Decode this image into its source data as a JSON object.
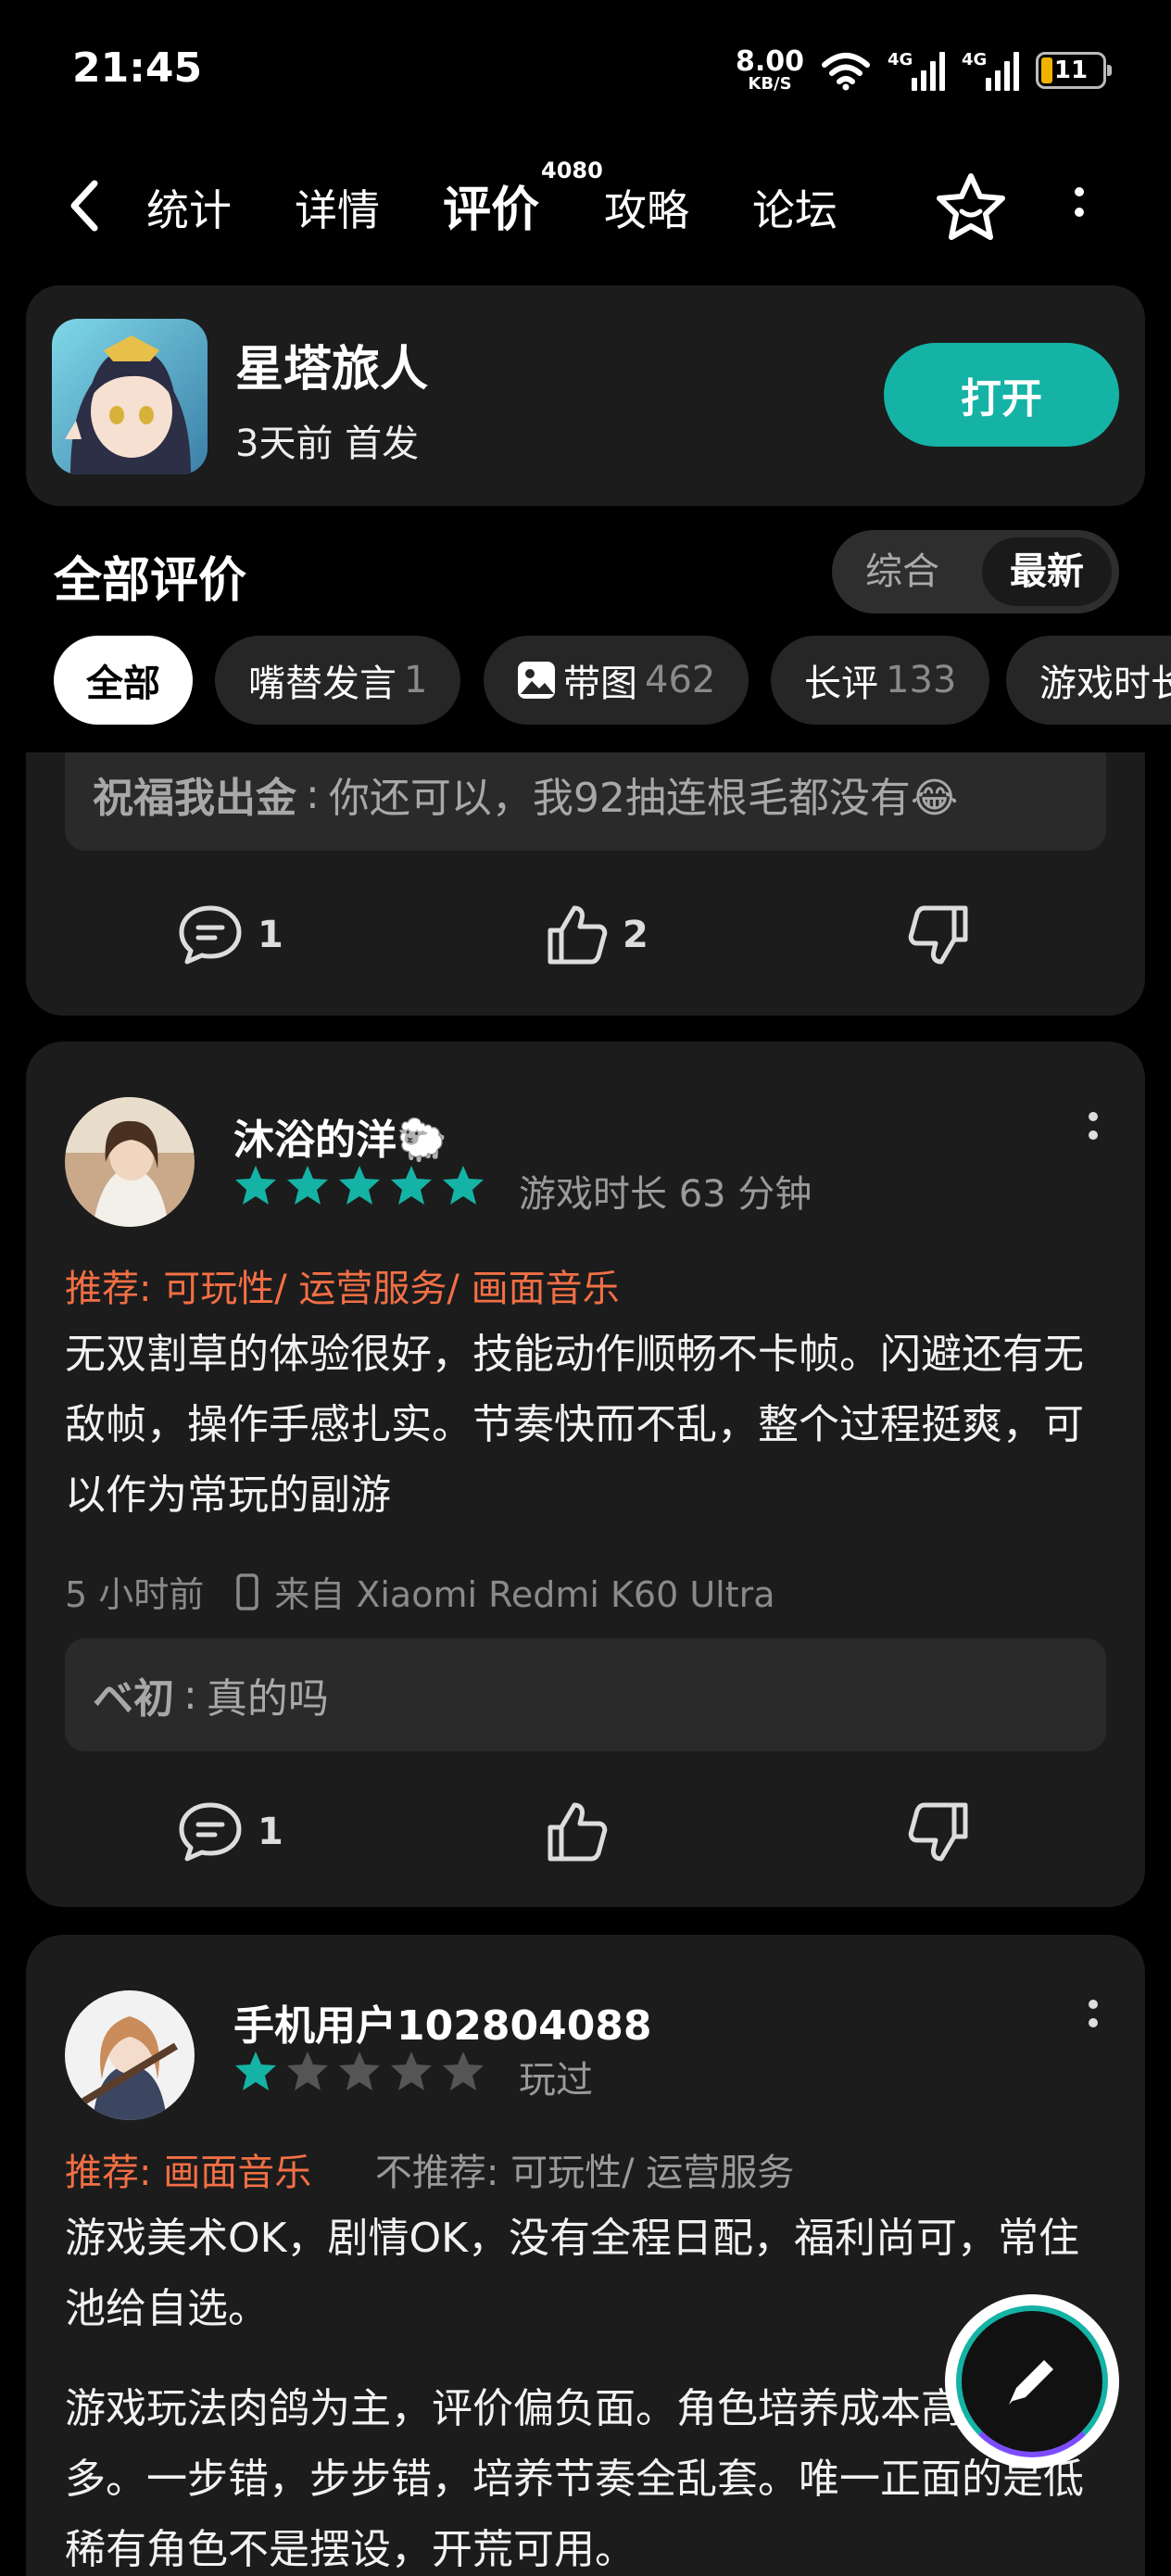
{
  "status_bar": {
    "time": "21:45",
    "net_speed": "8.00",
    "net_unit": "KB/S",
    "sim1": "4G",
    "sim2": "4G",
    "battery": "11"
  },
  "nav": {
    "tabs": [
      {
        "label": "统计"
      },
      {
        "label": "详情"
      },
      {
        "label": "评价",
        "badge": "4080"
      },
      {
        "label": "攻略"
      },
      {
        "label": "论坛"
      }
    ],
    "accent": "#15b3a5"
  },
  "game": {
    "title": "星塔旅人",
    "subtitle": "3天前 首发",
    "open_label": "打开"
  },
  "section": {
    "title": "全部评价",
    "sort_options": [
      "综合",
      "最新"
    ],
    "sort_selected": "最新"
  },
  "filters": [
    {
      "label": "全部",
      "count": ""
    },
    {
      "label": "嘴替发言",
      "count": "1"
    },
    {
      "label": "带图",
      "count": "462"
    },
    {
      "label": "长评",
      "count": "133"
    },
    {
      "label": "游戏时长",
      "count": ""
    }
  ],
  "reviews": [
    {
      "partial": true,
      "reply": {
        "name": "祝福我出金",
        "sep": ":",
        "text": "你还可以，我92抽连根毛都没有😂"
      },
      "comments": "1",
      "likes": "2"
    },
    {
      "username": "沐浴的洋🐑",
      "rating": 5,
      "playtime": "游戏时长 63 分钟",
      "recommend": "推荐: 可玩性/ 运营服务/ 画面音乐",
      "not_recommend": "",
      "text": "无双割草的体验很好，技能动作顺畅不卡帧。闪避还有无敌帧，操作手感扎实。节奏快而不乱，整个过程挺爽，可以作为常玩的副游",
      "time": "5 小时前",
      "device": "来自 Xiaomi Redmi K60 Ultra",
      "reply": {
        "name": "ベ初",
        "sep": ":",
        "text": "真的吗"
      },
      "comments": "1",
      "likes": ""
    },
    {
      "username": "手机用户102804088",
      "rating": 1,
      "playtime": "玩过",
      "recommend": "推荐: 画面音乐",
      "not_recommend": "不推荐: 可玩性/ 运营服务",
      "text": "游戏美术OK，剧情OK，没有全程日配，福利尚可，常住池给自选。",
      "text2": "游戏玩法肉鸽为主，评价偏负面。角色培养成本高，毒点多。一步错，步步错，培养节奏全乱套。唯一正面的是低稀有角色不是摆设，开荒可用。"
    }
  ]
}
